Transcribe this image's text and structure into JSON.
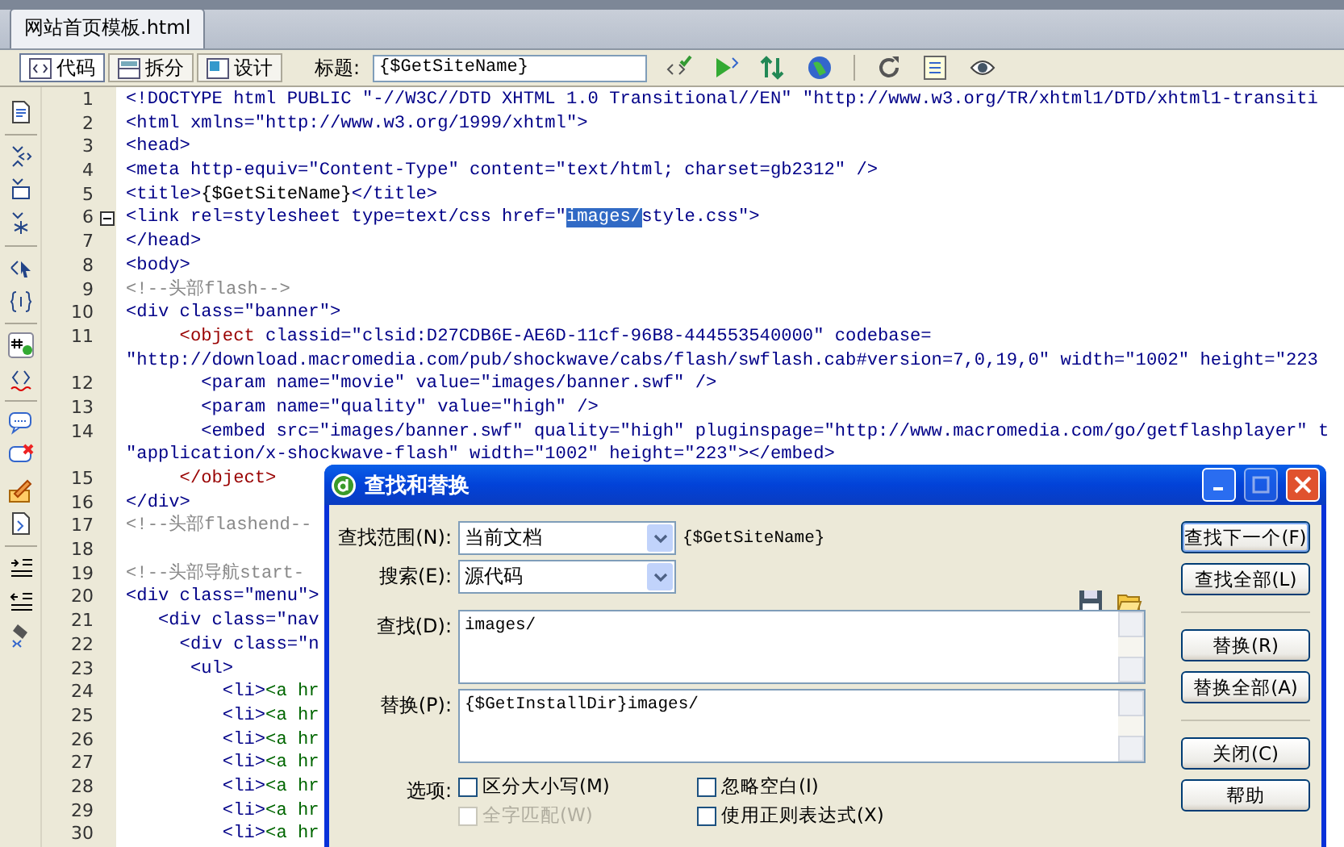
{
  "document_tab": {
    "label": "网站首页模板.html",
    "selected": true
  },
  "toolbar": {
    "view_buttons": [
      {
        "label": "代码",
        "selected": true
      },
      {
        "label": "拆分",
        "selected": false
      },
      {
        "label": "设计",
        "selected": false
      }
    ],
    "title_label": "标题:",
    "title_value": "{$GetSiteName}"
  },
  "code_lines": [
    {
      "n": "1",
      "fold": false,
      "segs": [
        {
          "kind": "tag",
          "t": "<!DOCTYPE html PUBLIC \"-//W3C//DTD XHTML 1.0 Transitional//EN\" \"http://www.w3.org/TR/xhtml1/DTD/xhtml1-transiti"
        }
      ]
    },
    {
      "n": "2",
      "fold": false,
      "segs": [
        {
          "kind": "tag",
          "t": "<html xmlns=\"http://www.w3.org/1999/xhtml\">"
        }
      ]
    },
    {
      "n": "3",
      "fold": false,
      "segs": [
        {
          "kind": "tag",
          "t": "<head>"
        }
      ]
    },
    {
      "n": "4",
      "fold": false,
      "segs": [
        {
          "kind": "tag",
          "t": "<meta http-equiv=\"Content-Type\" content=\"text/html; charset=gb2312\" />"
        }
      ]
    },
    {
      "n": "5",
      "fold": false,
      "segs": [
        {
          "kind": "tag",
          "t": "<title>"
        },
        {
          "kind": "text",
          "t": "{$GetSiteName}"
        },
        {
          "kind": "tag",
          "t": "</title>"
        }
      ]
    },
    {
      "n": "6",
      "fold": true,
      "segs": [
        {
          "kind": "tag",
          "t": "<link rel=stylesheet type=text/css href=\""
        },
        {
          "kind": "selected",
          "t": "images/"
        },
        {
          "kind": "tag",
          "t": "style.css\">"
        }
      ]
    },
    {
      "n": "7",
      "fold": false,
      "segs": [
        {
          "kind": "tag",
          "t": "</head>"
        }
      ]
    },
    {
      "n": "8",
      "fold": false,
      "segs": [
        {
          "kind": "tag",
          "t": "<body>"
        }
      ]
    },
    {
      "n": "9",
      "fold": false,
      "segs": [
        {
          "kind": "comment",
          "t": "<!--头部flash-->"
        }
      ]
    },
    {
      "n": "10",
      "fold": false,
      "segs": [
        {
          "kind": "tag",
          "t": "<div class=\"banner\">"
        }
      ]
    },
    {
      "n": "11",
      "fold": false,
      "segs": [
        {
          "kind": "object",
          "t": "     <object"
        },
        {
          "kind": "tag",
          "t": " classid=\"clsid:D27CDB6E-AE6D-11cf-96B8-444553540000\" codebase="
        }
      ]
    },
    {
      "fold": false,
      "segs": [
        {
          "kind": "tag",
          "t": "\"http://download.macromedia.com/pub/shockwave/cabs/flash/swflash.cab#version=7,0,19,0\" width=\"1002\" height=\"223"
        }
      ]
    },
    {
      "n": "12",
      "fold": false,
      "segs": [
        {
          "kind": "tag",
          "t": "       <param name=\"movie\" value=\"images/banner.swf\" />"
        }
      ]
    },
    {
      "n": "13",
      "fold": false,
      "segs": [
        {
          "kind": "tag",
          "t": "       <param name=\"quality\" value=\"high\" />"
        }
      ]
    },
    {
      "n": "14",
      "fold": false,
      "segs": [
        {
          "kind": "tag",
          "t": "       <embed src=\"images/banner.swf\" quality=\"high\" pluginspage=\"http://www.macromedia.com/go/getflashplayer\" t"
        }
      ]
    },
    {
      "fold": false,
      "segs": [
        {
          "kind": "tag",
          "t": "\"application/x-shockwave-flash\" width=\"1002\" height=\"223\"></embed>"
        }
      ]
    },
    {
      "n": "15",
      "fold": false,
      "segs": [
        {
          "kind": "object",
          "t": "     </object>"
        }
      ]
    },
    {
      "n": "16",
      "fold": false,
      "segs": [
        {
          "kind": "tag",
          "t": "</div>"
        }
      ]
    },
    {
      "n": "17",
      "fold": false,
      "segs": [
        {
          "kind": "comment",
          "t": "<!--头部flashend--"
        }
      ]
    },
    {
      "n": "18",
      "fold": false
    },
    {
      "n": "19",
      "fold": false,
      "segs": [
        {
          "kind": "comment",
          "t": "<!--头部导航start-"
        }
      ]
    },
    {
      "n": "20",
      "fold": false,
      "segs": [
        {
          "kind": "tag",
          "t": "<div class=\"menu\">"
        }
      ]
    },
    {
      "n": "21",
      "fold": false,
      "segs": [
        {
          "kind": "tag",
          "t": "   <div class=\"nav"
        }
      ]
    },
    {
      "n": "22",
      "fold": false,
      "segs": [
        {
          "kind": "tag",
          "t": "     <div class=\"n"
        }
      ]
    },
    {
      "n": "23",
      "fold": false,
      "segs": [
        {
          "kind": "tag",
          "t": "      <ul>"
        }
      ]
    },
    {
      "n": "24",
      "fold": false,
      "segs": [
        {
          "kind": "tag",
          "t": "         <li>"
        },
        {
          "kind": "anchor",
          "t": "<a hr"
        }
      ]
    },
    {
      "n": "25",
      "fold": false,
      "segs": [
        {
          "kind": "tag",
          "t": "         <li>"
        },
        {
          "kind": "anchor",
          "t": "<a hr"
        }
      ]
    },
    {
      "n": "26",
      "fold": false,
      "segs": [
        {
          "kind": "tag",
          "t": "         <li>"
        },
        {
          "kind": "anchor",
          "t": "<a hr"
        }
      ]
    },
    {
      "n": "27",
      "fold": false,
      "segs": [
        {
          "kind": "tag",
          "t": "         <li>"
        },
        {
          "kind": "anchor",
          "t": "<a hr"
        }
      ]
    },
    {
      "n": "28",
      "fold": false,
      "segs": [
        {
          "kind": "tag",
          "t": "         <li>"
        },
        {
          "kind": "anchor",
          "t": "<a hr"
        }
      ]
    },
    {
      "n": "29",
      "fold": false,
      "segs": [
        {
          "kind": "tag",
          "t": "         <li>"
        },
        {
          "kind": "anchor",
          "t": "<a hr"
        }
      ]
    },
    {
      "n": "30",
      "fold": false,
      "segs": [
        {
          "kind": "tag",
          "t": "         <li>"
        },
        {
          "kind": "anchor",
          "t": "<a hr"
        }
      ]
    }
  ],
  "dialog": {
    "title": "查找和替换",
    "scope_label": "查找范围(N):",
    "scope_value": "当前文档",
    "scope_note": "{$GetSiteName}",
    "search_label": "搜索(E):",
    "search_value": "源代码",
    "find_label": "查找(D):",
    "find_value": "images/",
    "replace_label": "替换(P):",
    "replace_value": "{$GetInstallDir}images/",
    "options_label": "选项:",
    "options": [
      {
        "label": "区分大小写(M)",
        "checked": false,
        "disabled": false
      },
      {
        "label": "忽略空白(I)",
        "checked": false,
        "disabled": false
      },
      {
        "label": "全字匹配(W)",
        "checked": false,
        "disabled": true
      },
      {
        "label": "使用正则表达式(X)",
        "checked": false,
        "disabled": false
      }
    ],
    "button_groups": [
      [
        {
          "label": "查找下一个(F)",
          "default": true
        },
        {
          "label": "查找全部(L)",
          "default": false
        }
      ],
      [
        {
          "label": "替换(R)",
          "default": false
        },
        {
          "label": "替换全部(A)",
          "default": false
        }
      ],
      [
        {
          "label": "关闭(C)",
          "default": false
        },
        {
          "label": "帮助",
          "default": false
        }
      ]
    ]
  }
}
